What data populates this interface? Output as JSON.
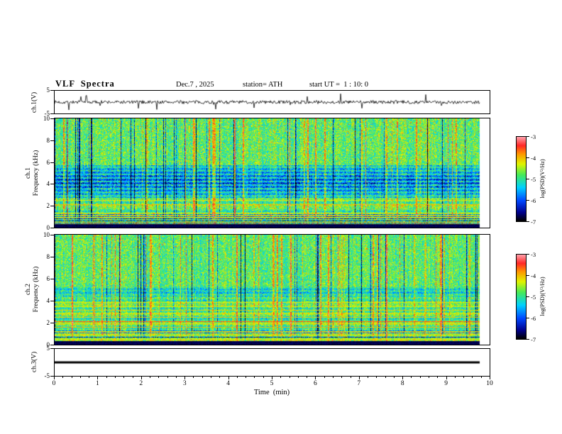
{
  "header": {
    "title": "VLF  Spectra",
    "date": "Dec.7 , 2025",
    "station": "station= ATH",
    "start_ut": "start UT =  1 : 10: 0"
  },
  "axes": {
    "x_label": "Time  (min)",
    "x_ticks": [
      "0",
      "1",
      "2",
      "3",
      "4",
      "5",
      "6",
      "7",
      "8",
      "9",
      "10"
    ],
    "x_minor_per_major": 5
  },
  "colorbar": {
    "label": "log(PSD)(V²/Hz)",
    "ticks": [
      "-3",
      "-4",
      "-5",
      "-6",
      "-7"
    ]
  },
  "panels": {
    "ch1_wave": {
      "ylabel": "ch.1(V)",
      "ytick_top": "5",
      "ytick_bottom": "-5"
    },
    "ch1_spec": {
      "ylabel_line1": "ch.1",
      "ylabel_line2": "Frequency  (kHz)",
      "yticks": [
        "10",
        "8",
        "6",
        "4",
        "2",
        "0"
      ]
    },
    "ch2_spec": {
      "ylabel_line1": "ch.2",
      "ylabel_line2": "Frequency  (kHz)",
      "yticks": [
        "10",
        "8",
        "6",
        "4",
        "2",
        "0"
      ]
    },
    "ch3_wave": {
      "ylabel": "ch.3(V)",
      "ytick_top": "5",
      "ytick_bottom": "-5"
    }
  },
  "chart_data": [
    {
      "id": "ch1_wave",
      "type": "line",
      "ylabel": "ch.1(V)",
      "xlim": [
        0,
        10
      ],
      "ylim": [
        -5,
        5
      ],
      "data_end_min": 9.78,
      "description": "Broadband noisy VLF time series centered on 0 V, typical amplitude about ±1 V with frequent impulsive sferic spikes reaching roughly ±4 V, running from t=0 to about t=9.78 min",
      "gen": {
        "seed": 7,
        "amp": 0.75,
        "spike_prob": 0.035,
        "spike_amp": 3.0
      }
    },
    {
      "id": "ch1_spec",
      "type": "heatmap",
      "xlabel": "Time (min)",
      "ylabel": "Frequency (kHz)",
      "xlim": [
        0,
        10
      ],
      "ylim": [
        0,
        10
      ],
      "zlabel": "log(PSD)(V²/Hz)",
      "zlim": [
        -7,
        -3
      ],
      "data_end_min": 9.78,
      "description": "Spectrogram: green background near -4.5 with dense vertical sferic striations (bright yellow-green and dark navy columns), a suppressed deep-blue band from about 2.7 to 5.7 kHz with darker horizontal strata, narrowband emission lines near 0.45, 0.9, 2.1 and 2.5 kHz, banded structure below ~2.4 kHz, near-black band below ~0.3 kHz, red speckles near the top",
      "gen": {
        "seed": 101,
        "base": 0.56,
        "noise": 0.16,
        "lowband_top": 2.4,
        "quiet": [
          2.7,
          5.7
        ],
        "quiet_depth": 0.32,
        "black_below": 0.28,
        "lines": [
          [
            0.45,
            0.1
          ],
          [
            0.9,
            0.1
          ],
          [
            1.3,
            0.08
          ],
          [
            2.08,
            0.18
          ],
          [
            2.5,
            0.13
          ]
        ]
      }
    },
    {
      "id": "ch2_spec",
      "type": "heatmap",
      "xlabel": "Time (min)",
      "ylabel": "Frequency (kHz)",
      "xlim": [
        0,
        10
      ],
      "ylim": [
        0,
        10
      ],
      "zlabel": "log(PSD)(V²/Hz)",
      "zlim": [
        -7,
        -3
      ],
      "data_end_min": 9.78,
      "description": "Spectrogram: green background with vertical sferic striations above ~4 kHz, strongly banded cyan/green region below ~4.2 kHz crossed by many thin horizontal narrowband lines (strong orange-red line near 2.1 kHz, others near 0.85, 1.2, 1.55, 1.9, 2.45, 2.8, 3.1, 3.45, 3.8 kHz), mild suppressed band 4.35-5.3 kHz, near-black band below ~0.3 kHz",
      "gen": {
        "seed": 202,
        "base": 0.55,
        "noise": 0.15,
        "lowband_top": 4.2,
        "quiet": [
          4.35,
          5.3
        ],
        "quiet_depth": 0.16,
        "black_below": 0.3,
        "lines": [
          [
            0.45,
            0.12
          ],
          [
            0.85,
            0.15
          ],
          [
            1.2,
            0.12
          ],
          [
            1.55,
            0.2
          ],
          [
            1.9,
            0.14
          ],
          [
            2.1,
            0.3
          ],
          [
            2.45,
            0.18
          ],
          [
            2.8,
            0.13
          ],
          [
            3.1,
            0.17
          ],
          [
            3.45,
            0.12
          ],
          [
            3.8,
            0.14
          ]
        ]
      }
    },
    {
      "id": "ch3_wave",
      "type": "line",
      "ylabel": "ch.3(V)",
      "xlim": [
        0,
        10
      ],
      "ylim": [
        -5,
        5
      ],
      "data_end_min": 9.78,
      "description": "Thick flat black trace constant at 0 V for the full record (inactive channel)",
      "gen": {
        "flat": 0
      }
    }
  ]
}
